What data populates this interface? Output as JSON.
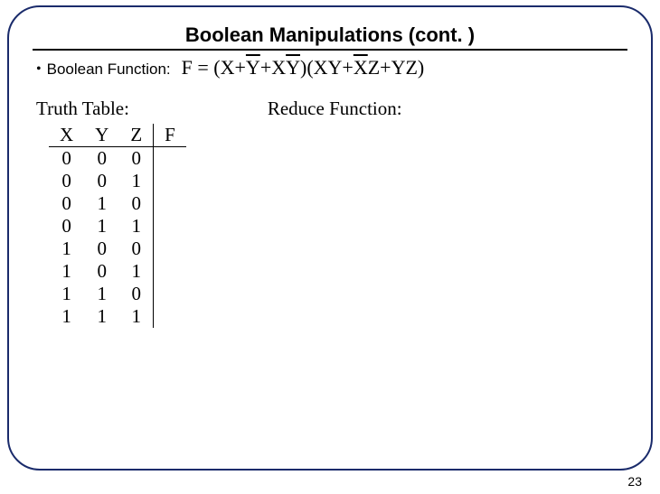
{
  "title": "Boolean Manipulations (cont. )",
  "bullet": {
    "label": "Boolean Function:",
    "expr_parts": {
      "p1": "F = (X+",
      "ybar": "Y",
      "p2": "+X",
      "ybar2": "Y",
      "p3": ")(XY+",
      "xbar": "X",
      "p4": "Z+YZ)"
    }
  },
  "truth_table": {
    "title": "Truth Table:",
    "headers": [
      "X",
      "Y",
      "Z",
      "F"
    ],
    "rows": [
      [
        "0",
        "0",
        "0",
        ""
      ],
      [
        "0",
        "0",
        "1",
        ""
      ],
      [
        "0",
        "1",
        "0",
        ""
      ],
      [
        "0",
        "1",
        "1",
        ""
      ],
      [
        "1",
        "0",
        "0",
        ""
      ],
      [
        "1",
        "0",
        "1",
        ""
      ],
      [
        "1",
        "1",
        "0",
        ""
      ],
      [
        "1",
        "1",
        "1",
        ""
      ]
    ]
  },
  "reduce_title": "Reduce Function:",
  "page_number": "23"
}
